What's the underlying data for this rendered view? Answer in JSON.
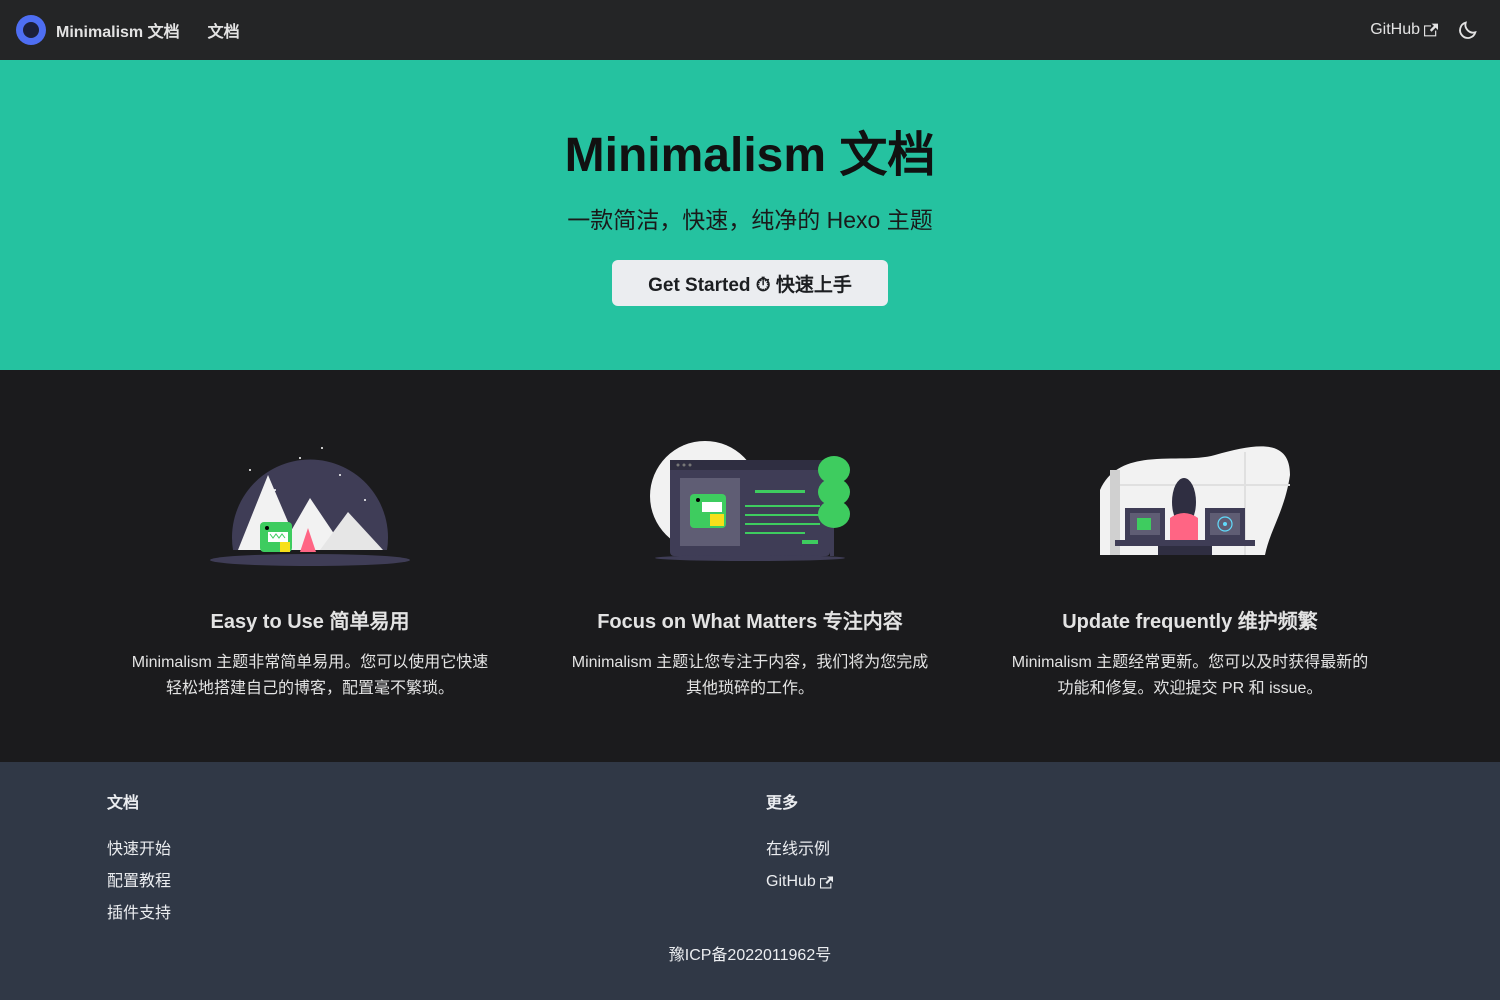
{
  "navbar": {
    "brand_title": "Minimalism 文档",
    "docs_link": "文档",
    "github_link": "GitHub"
  },
  "hero": {
    "title": "Minimalism 文档",
    "subtitle": "一款简洁，快速，纯净的 Hexo 主题",
    "button_label": "Get Started ⏱ 快速上手"
  },
  "features": [
    {
      "title": "Easy to Use 简单易用",
      "description": "Minimalism 主题非常简单易用。您可以使用它快速轻松地搭建自己的博客，配置毫不繁琐。"
    },
    {
      "title": "Focus on What Matters 专注内容",
      "description": "Minimalism 主题让您专注于内容，我们将为您完成其他琐碎的工作。"
    },
    {
      "title": "Update frequently 维护频繁",
      "description": "Minimalism 主题经常更新。您可以及时获得最新的功能和修复。欢迎提交 PR 和 issue。"
    }
  ],
  "footer": {
    "columns": [
      {
        "heading": "文档",
        "links": [
          "快速开始",
          "配置教程",
          "插件支持"
        ]
      },
      {
        "heading": "更多",
        "links": [
          "在线示例",
          "GitHub"
        ]
      }
    ],
    "copyright": "豫ICP备2022011962号"
  },
  "colors": {
    "brand": "#4e6ef2",
    "hero_bg": "#25c2a0",
    "navbar_bg": "#242526",
    "features_bg": "#1b1b1d",
    "footer_bg": "#303846"
  }
}
